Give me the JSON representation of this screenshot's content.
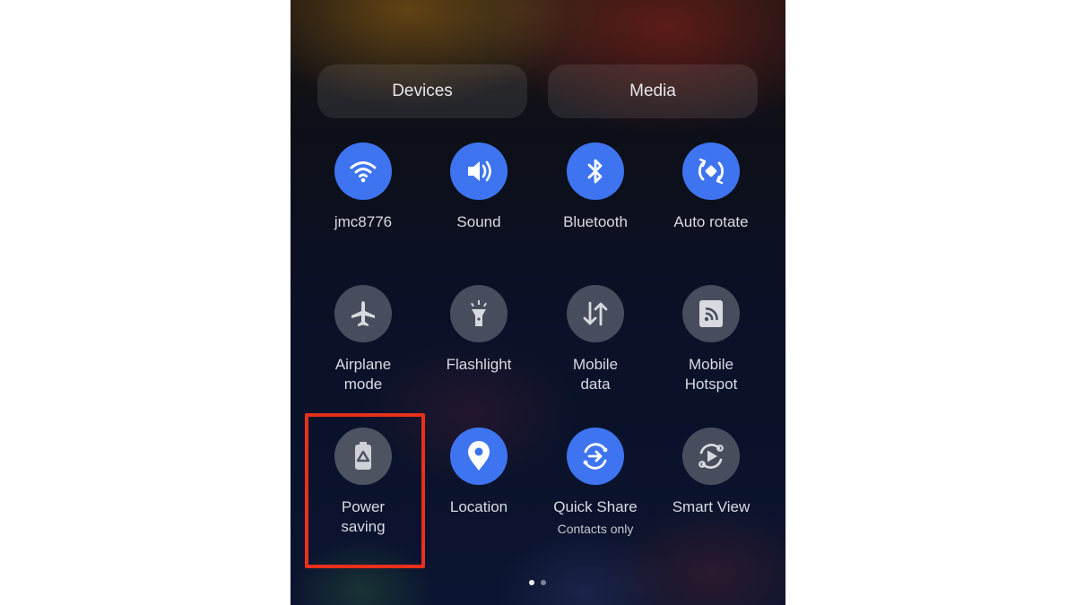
{
  "panel": {
    "tabs": [
      {
        "label": "Devices"
      },
      {
        "label": "Media"
      }
    ]
  },
  "tiles": [
    {
      "label": "jmc8776",
      "icon": "wifi-icon",
      "state": "on"
    },
    {
      "label": "Sound",
      "icon": "sound-icon",
      "state": "on"
    },
    {
      "label": "Bluetooth",
      "icon": "bluetooth-icon",
      "state": "on"
    },
    {
      "label": "Auto rotate",
      "icon": "auto-rotate-icon",
      "state": "on"
    },
    {
      "label_line1": "Airplane",
      "label_line2": "mode",
      "icon": "airplane-icon",
      "state": "off"
    },
    {
      "label": "Flashlight",
      "icon": "flashlight-icon",
      "state": "off"
    },
    {
      "label_line1": "Mobile",
      "label_line2": "data",
      "icon": "mobile-data-icon",
      "state": "off"
    },
    {
      "label_line1": "Mobile",
      "label_line2": "Hotspot",
      "icon": "hotspot-icon",
      "state": "off"
    },
    {
      "label_line1": "Power",
      "label_line2": "saving",
      "icon": "power-saving-icon",
      "state": "off",
      "highlighted": true
    },
    {
      "label": "Location",
      "icon": "location-icon",
      "state": "on"
    },
    {
      "label": "Quick Share",
      "sublabel": "Contacts only",
      "icon": "quick-share-icon",
      "state": "on"
    },
    {
      "label": "Smart View",
      "icon": "smart-view-icon",
      "state": "off"
    }
  ],
  "pagination": {
    "current": 1,
    "total": 2
  },
  "colors": {
    "tile_on": "#3e74f0",
    "tile_off": "#474d5c",
    "highlight": "#e8301a"
  }
}
